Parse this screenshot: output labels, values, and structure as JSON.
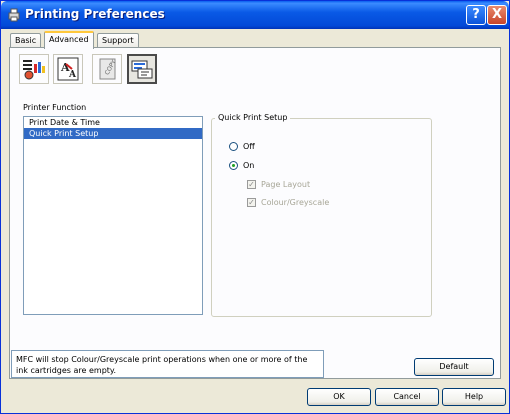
{
  "window": {
    "title": "Printing Preferences",
    "help_label": "?",
    "close_label": "X"
  },
  "tabs": [
    {
      "label": "Basic"
    },
    {
      "label": "Advanced"
    },
    {
      "label": "Support"
    }
  ],
  "toolbar": {
    "icons": [
      "quality-icon",
      "scaling-icon",
      "copy-icon",
      "function-icon"
    ]
  },
  "printer_function": {
    "label": "Printer Function",
    "items": [
      "Print Date & Time",
      "Quick Print Setup"
    ],
    "selected_index": 1
  },
  "quick_print_setup": {
    "title": "Quick Print Setup",
    "off_label": "Off",
    "on_label": "On",
    "selected": "On",
    "page_layout_label": "Page Layout",
    "page_layout_checked": true,
    "colour_label": "Colour/Greyscale",
    "colour_checked": true
  },
  "message": "MFC will stop Colour/Greyscale print operations when one or more of the ink cartridges are empty.",
  "buttons": {
    "default_label": "Default",
    "ok_label": "OK",
    "cancel_label": "Cancel",
    "help_label": "Help"
  },
  "colors": {
    "accent": "#316AC5",
    "titlebar": "#0A5AE6"
  }
}
